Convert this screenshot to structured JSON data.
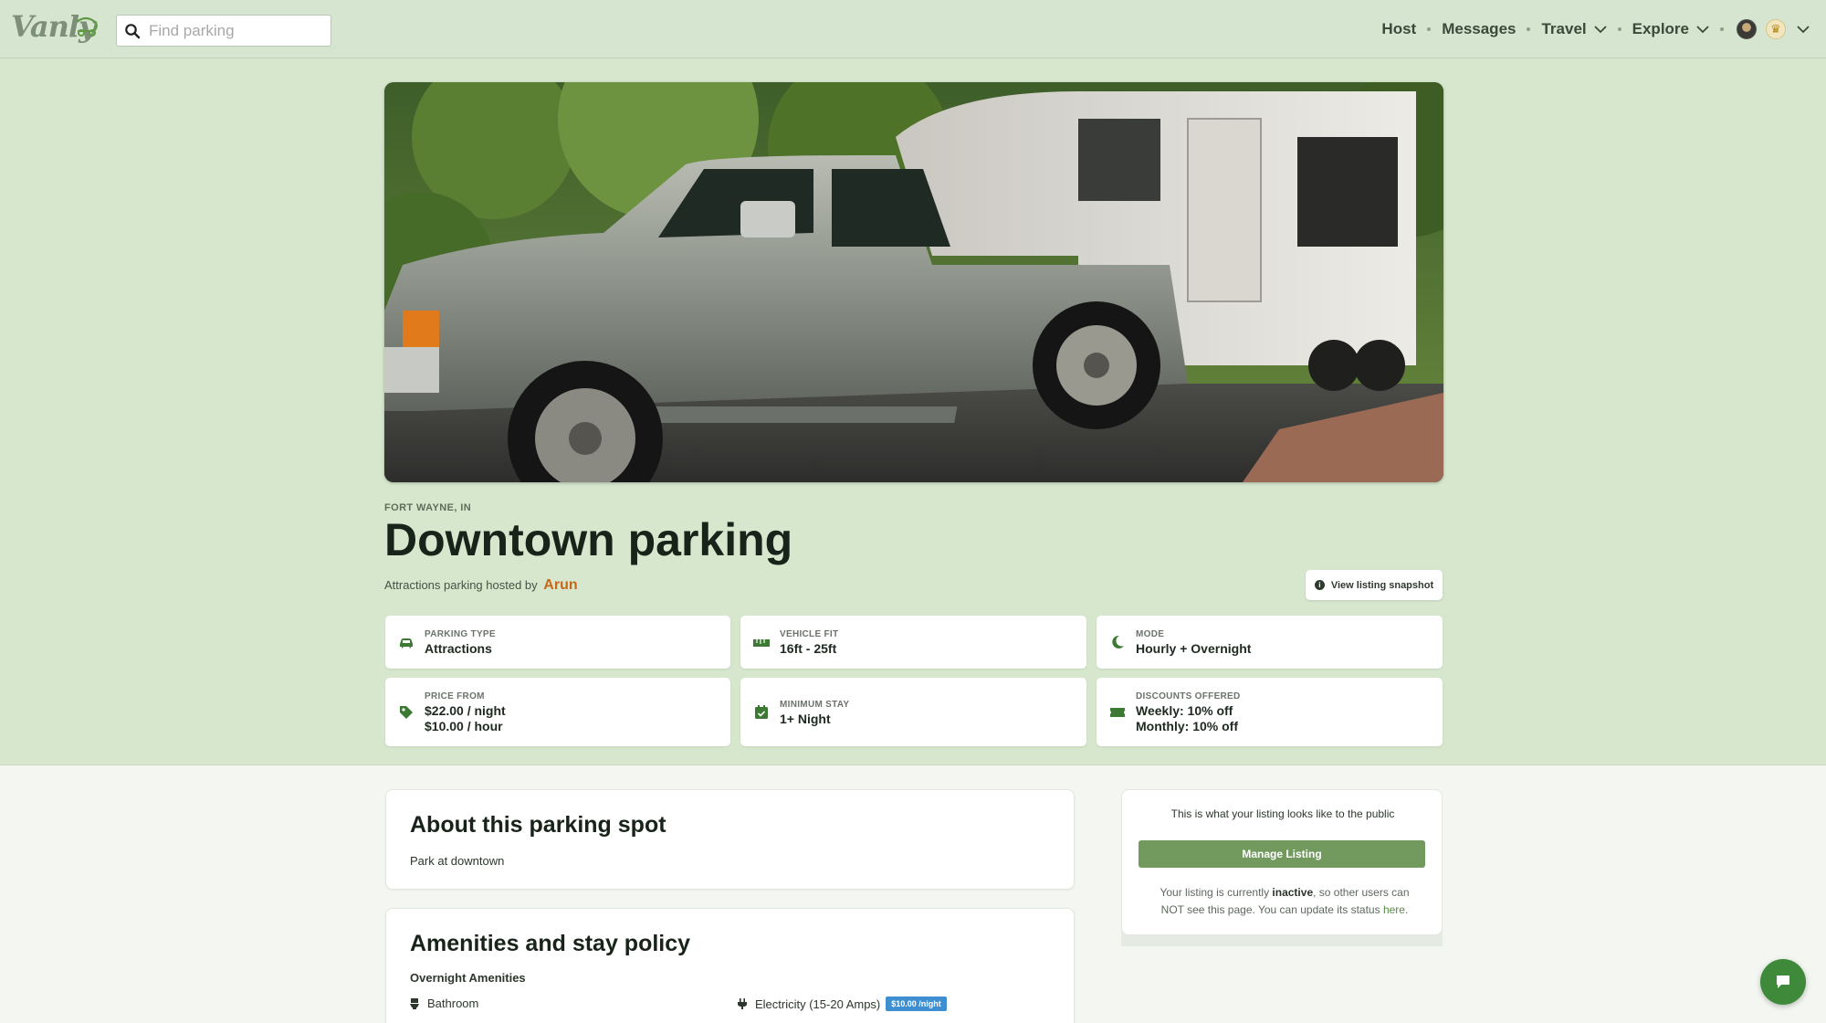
{
  "brand": {
    "logo_text": "Vanly"
  },
  "search": {
    "placeholder": "Find parking"
  },
  "nav": {
    "host": "Host",
    "messages": "Messages",
    "travel": "Travel",
    "explore": "Explore"
  },
  "listing": {
    "location": "FORT WAYNE, IN",
    "title": "Downtown parking",
    "hosted_prefix": "Attractions parking hosted by",
    "host_name": "Arun",
    "snapshot_label": "View listing snapshot"
  },
  "info_cards": {
    "parking_type": {
      "label": "PARKING TYPE",
      "value": "Attractions"
    },
    "vehicle_fit": {
      "label": "VEHICLE FIT",
      "value": "16ft - 25ft"
    },
    "mode": {
      "label": "MODE",
      "value": "Hourly + Overnight"
    },
    "price": {
      "label": "PRICE FROM",
      "line1": "$22.00 / night",
      "line2": "$10.00 / hour"
    },
    "min_stay": {
      "label": "MINIMUM STAY",
      "value": "1+ Night"
    },
    "discounts": {
      "label": "DISCOUNTS OFFERED",
      "line1": "Weekly: 10% off",
      "line2": "Monthly: 10% off"
    }
  },
  "about": {
    "title": "About this parking spot",
    "text": "Park at downtown"
  },
  "amenities": {
    "title": "Amenities and stay policy",
    "subtitle": "Overnight Amenities",
    "items": [
      {
        "label": "Bathroom"
      },
      {
        "label": "Electricity (15-20 Amps)",
        "price": "$10.00 /night"
      }
    ]
  },
  "owner_panel": {
    "note": "This is what your listing looks like to the public",
    "manage_label": "Manage Listing",
    "status_pre": "Your listing is currently",
    "status_word": "inactive",
    "status_post": ", so other users can NOT see this page. You can update its status",
    "status_link": "here",
    "status_end": "."
  },
  "colors": {
    "header_bg": "#d6e5cf",
    "hero_bg": "#d6e7cd",
    "accent_green": "#729a5f",
    "host_link": "#c5681a",
    "price_tag": "#3d8fd1",
    "chat_button": "#3f8a3a"
  },
  "icons": {
    "search": "magnifier-icon",
    "parking_type": "car-icon",
    "vehicle_fit": "ruler-icon",
    "mode": "moon-icon",
    "price": "tag-icon",
    "min_stay": "calendar-icon",
    "discounts": "ticket-icon",
    "bathroom": "toilet-icon",
    "electricity": "plug-icon",
    "chat": "chat-bubble-icon"
  }
}
